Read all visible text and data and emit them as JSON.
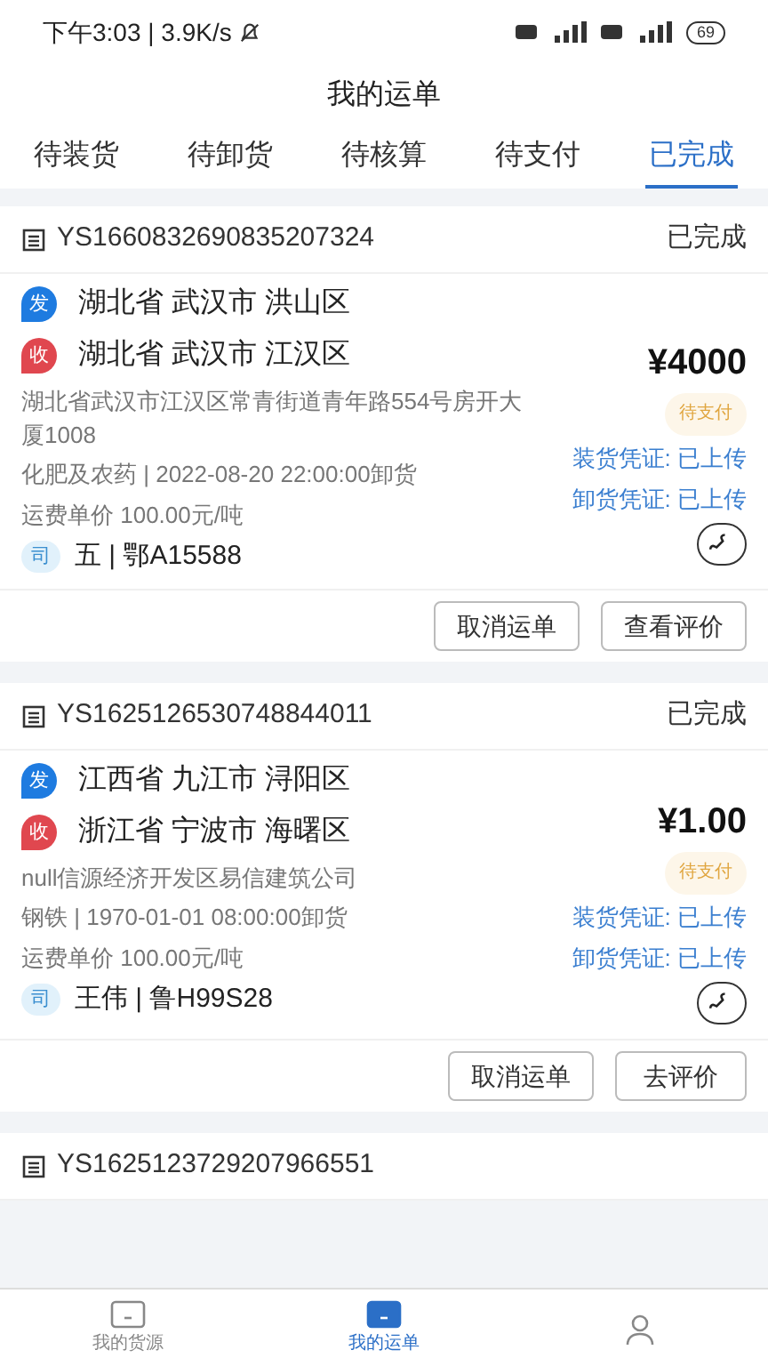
{
  "status_bar": {
    "time": "下午3:03 | 3.9K/s",
    "battery": "69"
  },
  "title": "我的运单",
  "tabs": [
    {
      "label": "待装货",
      "selected": false
    },
    {
      "label": "待卸货",
      "selected": false
    },
    {
      "label": "待核算",
      "selected": false
    },
    {
      "label": "待支付",
      "selected": false
    },
    {
      "label": "已完成",
      "selected": true
    }
  ],
  "orders": [
    {
      "number": "YS1660832690835207324",
      "status": "已完成",
      "from_badge": "发",
      "from": "湖北省 武汉市 洪山区",
      "to_badge": "收",
      "to": "湖北省 武汉市 江汉区",
      "price": "¥4000",
      "address": "湖北省武汉市江汉区常青街道青年路554号房开大厦1008",
      "pay_tag": "待支付",
      "cargo": "化肥及农药 | 2022-08-20 22:00:00卸货",
      "load_proof": "装货凭证: 已上传",
      "unit_price": "运费单价 100.00元/吨",
      "unload_proof": "卸货凭证: 已上传",
      "driver_badge": "司",
      "driver": "五 | 鄂A15588",
      "buttons": [
        "取消运单",
        "查看评价"
      ]
    },
    {
      "number": "YS1625126530748844011",
      "status": "已完成",
      "from_badge": "发",
      "from": "江西省 九江市 浔阳区",
      "to_badge": "收",
      "to": "浙江省 宁波市 海曙区",
      "price": "¥1.00",
      "address": "null信源经济开发区易信建筑公司",
      "pay_tag": "待支付",
      "cargo": "钢铁 | 1970-01-01 08:00:00卸货",
      "load_proof": "装货凭证: 已上传",
      "unit_price": "运费单价 100.00元/吨",
      "unload_proof": "卸货凭证: 已上传",
      "driver_badge": "司",
      "driver": "王伟 | 鲁H99S28",
      "buttons": [
        "取消运单",
        "去评价"
      ]
    },
    {
      "number": "YS1625123729207966551"
    }
  ],
  "bottom_nav": [
    {
      "label": "我的货源",
      "selected": false
    },
    {
      "label": "我的运单",
      "selected": true
    }
  ]
}
